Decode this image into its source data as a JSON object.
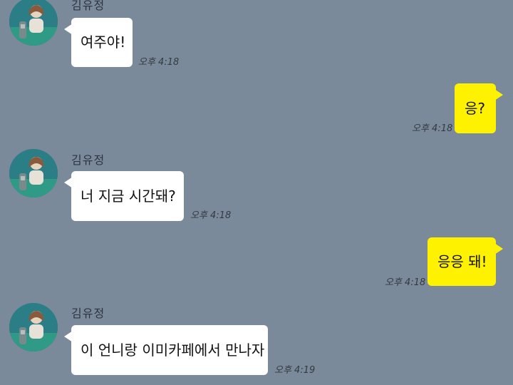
{
  "messages": [
    {
      "direction": "incoming",
      "sender": "김유정",
      "text": "여주야!",
      "time": "오후 4:18"
    },
    {
      "direction": "outgoing",
      "text": "응?",
      "time": "오후 4:18"
    },
    {
      "direction": "incoming",
      "sender": "김유정",
      "text": "너 지금 시간돼?",
      "time": "오후 4:18"
    },
    {
      "direction": "outgoing",
      "text": "응응 돼!",
      "time": "오후 4:18"
    },
    {
      "direction": "incoming",
      "sender": "김유정",
      "text": "이 언니랑 이미카페에서 만나자",
      "time": "오후 4:19"
    }
  ],
  "colors": {
    "background": "#7b8a9b",
    "incoming_bubble": "#ffffff",
    "outgoing_bubble": "#fff200"
  },
  "icons": {
    "avatar": "profile-photo"
  }
}
